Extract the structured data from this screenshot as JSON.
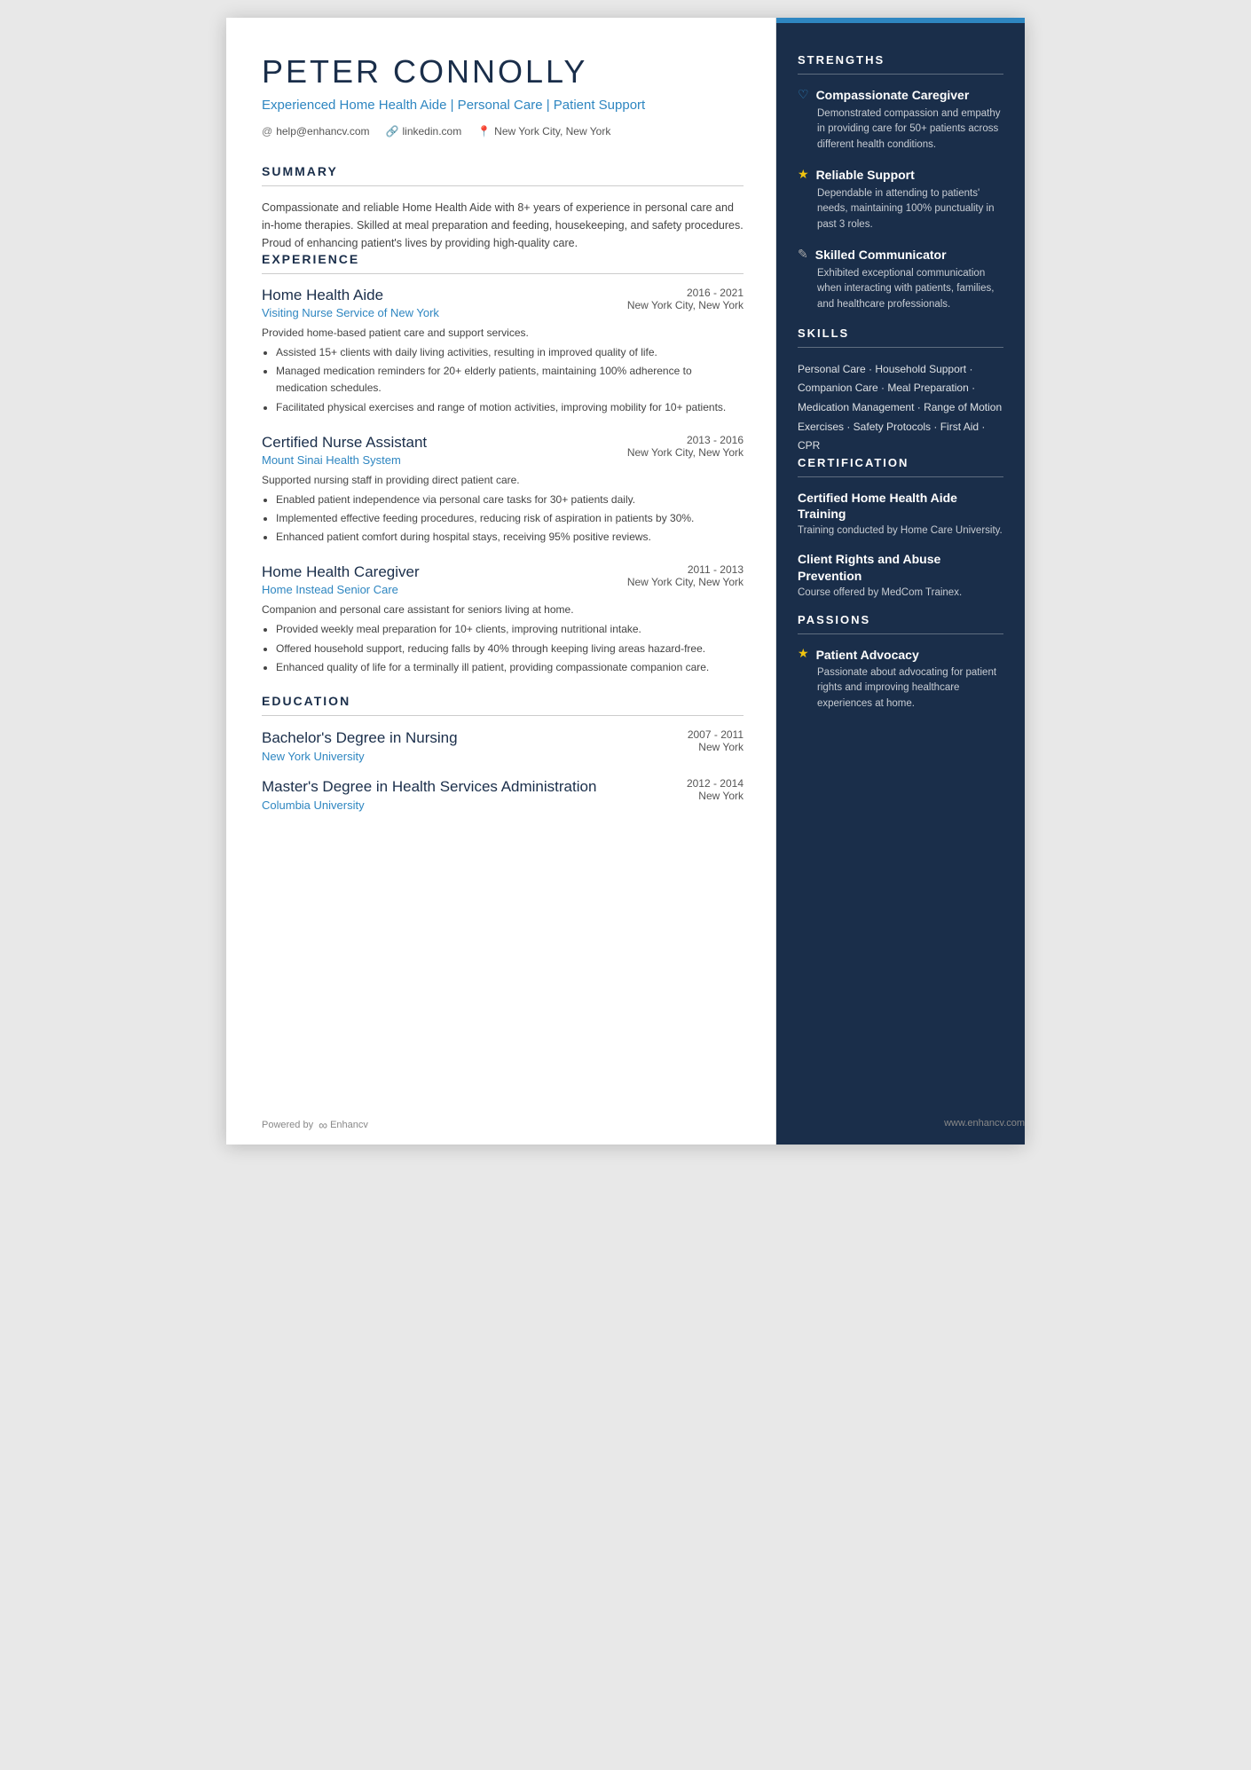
{
  "header": {
    "name": "PETER CONNOLLY",
    "subtitle": "Experienced Home Health Aide | Personal Care | Patient Support",
    "contact": {
      "email": "help@enhancv.com",
      "linkedin": "linkedin.com",
      "location": "New York City, New York"
    }
  },
  "summary": {
    "title": "SUMMARY",
    "text": "Compassionate and reliable Home Health Aide with 8+ years of experience in personal care and in-home therapies. Skilled at meal preparation and feeding, housekeeping, and safety procedures. Proud of enhancing patient's lives by providing high-quality care."
  },
  "experience": {
    "title": "EXPERIENCE",
    "entries": [
      {
        "title": "Home Health Aide",
        "company": "Visiting Nurse Service of New York",
        "dates": "2016 - 2021",
        "location": "New York City, New York",
        "description": "Provided home-based patient care and support services.",
        "bullets": [
          "Assisted 15+ clients with daily living activities, resulting in improved quality of life.",
          "Managed medication reminders for 20+ elderly patients, maintaining 100% adherence to medication schedules.",
          "Facilitated physical exercises and range of motion activities, improving mobility for 10+ patients."
        ]
      },
      {
        "title": "Certified Nurse Assistant",
        "company": "Mount Sinai Health System",
        "dates": "2013 - 2016",
        "location": "New York City, New York",
        "description": "Supported nursing staff in providing direct patient care.",
        "bullets": [
          "Enabled patient independence via personal care tasks for 30+ patients daily.",
          "Implemented effective feeding procedures, reducing risk of aspiration in patients by 30%.",
          "Enhanced patient comfort during hospital stays, receiving 95% positive reviews."
        ]
      },
      {
        "title": "Home Health Caregiver",
        "company": "Home Instead Senior Care",
        "dates": "2011 - 2013",
        "location": "New York City, New York",
        "description": "Companion and personal care assistant for seniors living at home.",
        "bullets": [
          "Provided weekly meal preparation for 10+ clients, improving nutritional intake.",
          "Offered household support, reducing falls by 40% through keeping living areas hazard-free.",
          "Enhanced quality of life for a terminally ill patient, providing compassionate companion care."
        ]
      }
    ]
  },
  "education": {
    "title": "EDUCATION",
    "entries": [
      {
        "degree": "Bachelor's Degree in Nursing",
        "school": "New York University",
        "dates": "2007 - 2011",
        "location": "New York"
      },
      {
        "degree": "Master's Degree in Health Services Administration",
        "school": "Columbia University",
        "dates": "2012 - 2014",
        "location": "New York"
      }
    ]
  },
  "strengths": {
    "title": "STRENGTHS",
    "items": [
      {
        "icon": "♡",
        "title": "Compassionate Caregiver",
        "desc": "Demonstrated compassion and empathy in providing care for 50+ patients across different health conditions."
      },
      {
        "icon": "★",
        "title": "Reliable Support",
        "desc": "Dependable in attending to patients' needs, maintaining 100% punctuality in past 3 roles."
      },
      {
        "icon": "✎",
        "title": "Skilled Communicator",
        "desc": "Exhibited exceptional communication when interacting with patients, families, and healthcare professionals."
      }
    ]
  },
  "skills": {
    "title": "SKILLS",
    "text": "Personal Care · Household Support · Companion Care · Meal Preparation · Medication Management · Range of Motion Exercises · Safety Protocols · First Aid · CPR"
  },
  "certification": {
    "title": "CERTIFICATION",
    "items": [
      {
        "title": "Certified Home Health Aide Training",
        "desc": "Training conducted by Home Care University."
      },
      {
        "title": "Client Rights and Abuse Prevention",
        "desc": "Course offered by MedCom Trainex."
      }
    ]
  },
  "passions": {
    "title": "PASSIONS",
    "items": [
      {
        "icon": "★",
        "title": "Patient Advocacy",
        "desc": "Passionate about advocating for patient rights and improving healthcare experiences at home."
      }
    ]
  },
  "footer": {
    "powered_by": "Powered by",
    "brand": "Enhancv",
    "website": "www.enhancv.com"
  }
}
